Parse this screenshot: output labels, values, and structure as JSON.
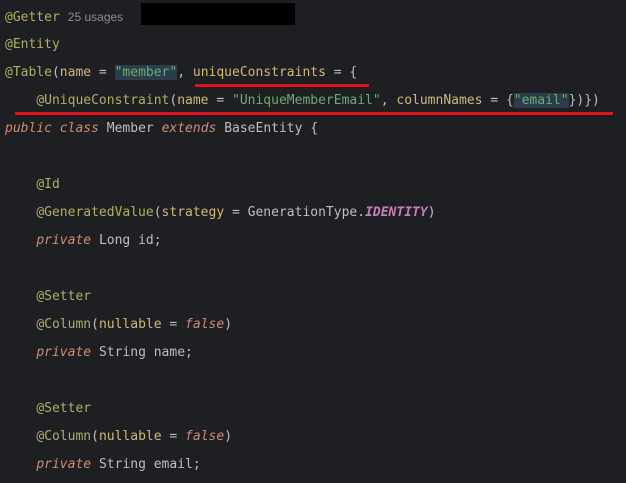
{
  "colors": {
    "background": "#1e1f22",
    "annotation": "#b3ae60",
    "parameter": "#d5b778",
    "string": "#6aab73",
    "keyword": "#cf8e6d",
    "underline": "#e0141c"
  },
  "line1": {
    "annotation": "@Getter",
    "usages": "25 usages"
  },
  "line2": {
    "annotation": "@Entity"
  },
  "line3": {
    "annotation": "@Table",
    "open": "(",
    "param_name": "name",
    "eq": " = ",
    "name_value": "\"member\"",
    "comma": ", ",
    "param_uc": "uniqueConstraints",
    "eq2": " = {"
  },
  "line4": {
    "indent": "    ",
    "annotation": "@UniqueConstraint",
    "open": "(",
    "param_name": "name",
    "eq": " = ",
    "name_value": "\"UniqueMemberEmail\"",
    "comma": ", ",
    "param_cols": "columnNames",
    "eq2": " = {",
    "cols_value": "\"email\"",
    "close": "})})"
  },
  "line5": {
    "kw_public": "public",
    "kw_class": "class",
    "class_name": "Member",
    "kw_extends": "extends",
    "super_name": "BaseEntity",
    "brace": "{"
  },
  "line7": {
    "annotation": "@Id"
  },
  "line8": {
    "annotation": "@GeneratedValue",
    "open": "(",
    "param": "strategy",
    "eq": " = ",
    "type": "GenerationType",
    "dot": ".",
    "const": "IDENTITY",
    "close": ")"
  },
  "line9": {
    "kw": "private",
    "type": "Long",
    "name": "id;"
  },
  "line11": {
    "annotation": "@Setter"
  },
  "line12": {
    "annotation": "@Column",
    "open": "(",
    "param": "nullable",
    "eq": " = ",
    "value": "false",
    "close": ")"
  },
  "line13": {
    "kw": "private",
    "type": "String",
    "name": "name;"
  },
  "line15": {
    "annotation": "@Setter"
  },
  "line16": {
    "annotation": "@Column",
    "open": "(",
    "param": "nullable",
    "eq": " = ",
    "value": "false",
    "close": ")"
  },
  "line17": {
    "kw": "private",
    "type": "String",
    "name": "email;"
  }
}
